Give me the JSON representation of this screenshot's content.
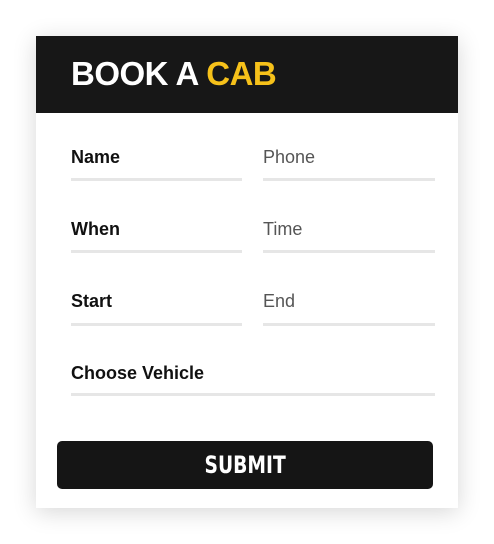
{
  "header": {
    "title_prefix": "BOOK A",
    "title_accent": "CAB",
    "accent_color": "#f6c11a",
    "background_color": "#171717"
  },
  "form": {
    "fields": [
      {
        "placeholder": "Name",
        "value": ""
      },
      {
        "placeholder": "Phone",
        "value": ""
      },
      {
        "placeholder": "When",
        "value": ""
      },
      {
        "placeholder": "Time",
        "value": ""
      },
      {
        "placeholder": "Start",
        "value": ""
      },
      {
        "placeholder": "End",
        "value": ""
      },
      {
        "placeholder": "Choose Vehicle",
        "value": ""
      }
    ],
    "submit_label": "SUBMIT"
  }
}
